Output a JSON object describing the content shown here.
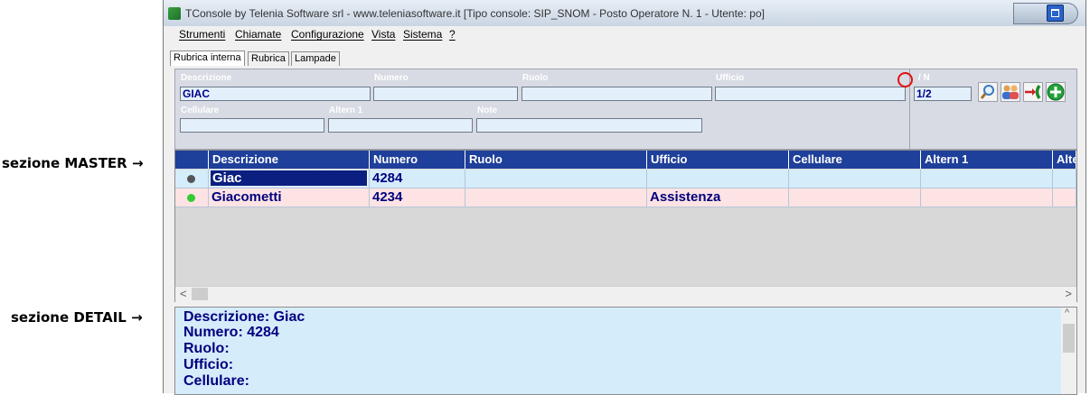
{
  "annotations": {
    "master": "sezione MASTER →",
    "detail": "sezione DETAIL →"
  },
  "window": {
    "title": "TConsole by Telenia Software srl - www.teleniasoftware.it   [Tipo console: SIP_SNOM - Posto Operatore N. 1 - Utente: po]"
  },
  "menu": [
    "Strumenti",
    "Chiamate",
    "Configurazione",
    "Vista",
    "Sistema",
    "?"
  ],
  "tabs": [
    "Rubrica interna",
    "Rubrica",
    "Lampade"
  ],
  "active_tab": "Rubrica interna",
  "search_form": {
    "labels": {
      "descrizione": "Descrizione",
      "numero": "Numero",
      "ruolo": "Ruolo",
      "ufficio": "Ufficio",
      "cellulare": "Cellulare",
      "altern1": "Altern 1",
      "note": "Note",
      "pager": "/ N"
    },
    "values": {
      "descrizione": "GIAC",
      "numero": "",
      "ruolo": "",
      "ufficio": "",
      "cellulare": "",
      "altern1": "",
      "note": "",
      "pager": "1/2"
    }
  },
  "toolbar_icons": [
    "search-icon",
    "contacts-icon",
    "transfer-call-icon",
    "add-icon"
  ],
  "grid": {
    "columns": [
      "",
      "Descrizione",
      "Numero",
      "Ruolo",
      "Ufficio",
      "Cellulare",
      "Altern 1",
      "Alte"
    ],
    "rows": [
      {
        "status_color": "#555555",
        "descrizione": "Giac",
        "numero": "4284",
        "ruolo": "",
        "ufficio": "",
        "cellulare": "",
        "altern1": "",
        "selected": true
      },
      {
        "status_color": "#33cc33",
        "descrizione": "Giacometti",
        "numero": "4234",
        "ruolo": "",
        "ufficio": "Assistenza",
        "cellulare": "",
        "altern1": "",
        "selected": false
      }
    ]
  },
  "detail": {
    "lines": [
      "Descrizione: Giac",
      "Numero: 4284",
      "Ruolo:",
      "Ufficio:",
      "Cellulare:"
    ]
  },
  "colors": {
    "header_bg": "#1e3f9a",
    "row1_bg": "#d5ecfb",
    "row2_bg": "#fde3e3",
    "detail_bg": "#d5ecfb",
    "data_text": "#00007f"
  }
}
